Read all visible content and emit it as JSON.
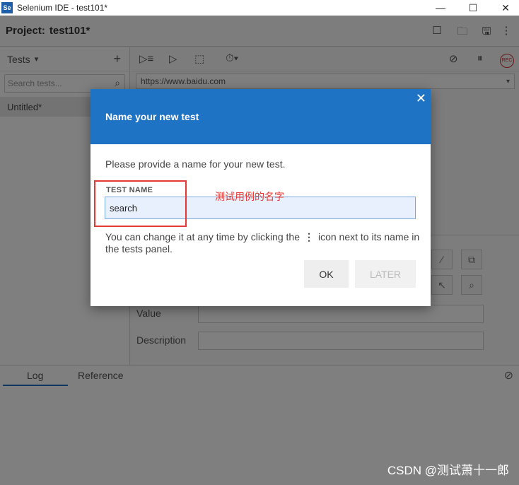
{
  "window": {
    "app_icon_text": "Se",
    "title": "Selenium IDE - test101*",
    "minimize": "—",
    "maximize": "☐",
    "close": "✕"
  },
  "project": {
    "label": "Project:",
    "name": "test101*"
  },
  "tests_panel": {
    "header": "Tests",
    "dropdown_icon": "▾",
    "add_icon": "+",
    "search_placeholder": "Search tests...",
    "search_icon": "⌕",
    "items": [
      "Untitled*"
    ]
  },
  "toolbar": {
    "run_all_icon": "▷≡",
    "run_icon": "▷",
    "step_icon": "⬚",
    "speed_icon": "⏱▾",
    "disable_breakpoints_icon": "⊘",
    "pause_icon": "⏸",
    "record_label": "REC"
  },
  "url_bar": {
    "value": "https://www.baidu.com",
    "caret": "▾"
  },
  "command_panel": {
    "value_label": "Value",
    "description_label": "Description"
  },
  "bottom_panel": {
    "tabs": [
      "Log",
      "Reference"
    ],
    "clear_icon": "⊘"
  },
  "dialog": {
    "title": "Name your new test",
    "close_icon": "✕",
    "prompt": "Please provide a name for your new test.",
    "field_caption": "TEST NAME",
    "input_value": "search",
    "hint_before": "You can change it at any time by clicking the",
    "hint_icon": "⋮",
    "hint_after": "icon next to its name in the tests panel.",
    "ok_label": "OK",
    "later_label": "LATER"
  },
  "annotation": {
    "text": "测试用例的名字"
  },
  "watermark": {
    "text": "CSDN @测试萧十一郎"
  },
  "colors": {
    "dialog_header": "#1f73c4",
    "annotation_red": "#e53935",
    "input_bg": "#e8f0fe"
  }
}
